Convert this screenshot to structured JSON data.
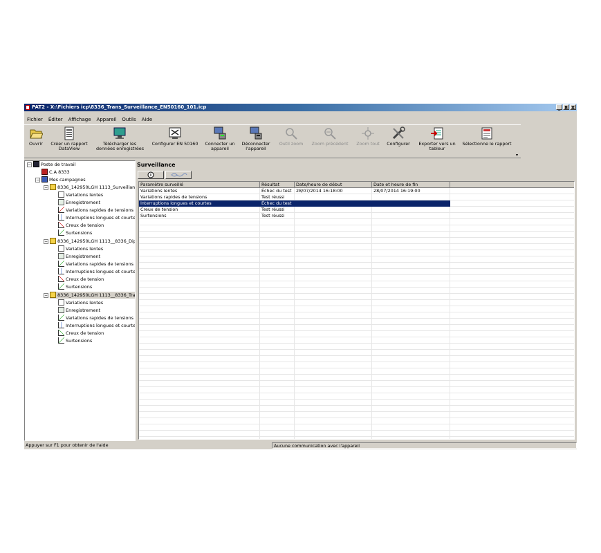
{
  "window": {
    "title": "PAT2 - X:\\Fichiers icp\\8336_Trans_Surveillance_EN50160_101.icp",
    "controls": [
      "_",
      "8",
      "X"
    ]
  },
  "menu": [
    "Fichier",
    "Éditer",
    "Affichage",
    "Appareil",
    "Outils",
    "Aide"
  ],
  "toolbar": [
    {
      "label1": "Ouvrir",
      "label2": "",
      "icon": "folder-open-icon",
      "enabled": true
    },
    {
      "label1": "Créer un rapport",
      "label2": "DataView",
      "icon": "report-icon",
      "enabled": true
    },
    {
      "label1": "Télécharger les",
      "label2": "données enregistrées",
      "icon": "download-icon",
      "enabled": true
    },
    {
      "label1": "Configurer EN 50160",
      "label2": "",
      "icon": "configure-en50160-icon",
      "enabled": true
    },
    {
      "label1": "Connecter un",
      "label2": "appareil",
      "icon": "connect-device-icon",
      "enabled": true
    },
    {
      "label1": "Déconnecter",
      "label2": "l'appareil",
      "icon": "disconnect-device-icon",
      "enabled": true
    },
    {
      "label1": "Outil zoom",
      "label2": "",
      "icon": "zoom-icon",
      "enabled": false
    },
    {
      "label1": "Zoom précédent",
      "label2": "",
      "icon": "zoom-previous-icon",
      "enabled": false
    },
    {
      "label1": "Zoom tout",
      "label2": "",
      "icon": "zoom-all-icon",
      "enabled": false
    },
    {
      "label1": "Configurer",
      "label2": "",
      "icon": "tools-icon",
      "enabled": true
    },
    {
      "label1": "Exporter vers un",
      "label2": "tableur",
      "icon": "export-icon",
      "enabled": true
    },
    {
      "label1": "Sélectionne le rapport",
      "label2": "",
      "icon": "select-report-icon",
      "enabled": true
    }
  ],
  "tree": {
    "root": "Poste de travail",
    "device": "C.A 8333",
    "campaigns": "Mes campagnes",
    "groups": [
      {
        "name": "8336_142950LGH 1113_Surveillanc",
        "children": [
          "Variations lentes",
          "Enregistrement",
          "Variations rapides de tensions",
          "Interruptions longues et courte",
          "Creux de tension",
          "Surtensions"
        ]
      },
      {
        "name": "8336_142950LGH 1113__8336_Dip",
        "children": [
          "Variations lentes",
          "Enregistrement",
          "Variations rapides de tensions",
          "Interruptions longues et courte",
          "Creux de tension",
          "Surtensions"
        ]
      },
      {
        "name": "8336_142950LGH 1113__8336_Tra",
        "children": [
          "Variations lentes",
          "Enregistrement",
          "Variations rapides de tensions",
          "Interruptions longues et courte",
          "Creux de tension",
          "Surtensions"
        ]
      }
    ]
  },
  "panel": {
    "title": "Surveillance",
    "columns": [
      "Paramètre surveillé",
      "Résultat",
      "Date/heure de début",
      "Date et heure de fin"
    ],
    "rows": [
      {
        "param": "Variations lentes",
        "result": "Échec du test",
        "start": "28/07/2014 16:18:00",
        "end": "28/07/2014 16:19:00",
        "selected": false
      },
      {
        "param": "Variations rapides de tensions",
        "result": "Test réussi",
        "start": "",
        "end": "",
        "selected": false
      },
      {
        "param": "Interruptions longues et courtes",
        "result": "Échec du test",
        "start": "",
        "end": "",
        "selected": true
      },
      {
        "param": "Creux de tension",
        "result": "Test réussi",
        "start": "",
        "end": "",
        "selected": false
      },
      {
        "param": "Surtensions",
        "result": "Test réussi",
        "start": "",
        "end": "",
        "selected": false
      }
    ]
  },
  "status": {
    "left": "Appuyer sur F1 pour obtenir de l'aide",
    "right": "Aucune communication avec l'appareil"
  },
  "colors": {
    "selection": "#0a246a",
    "titlebar": "#0a246a",
    "chrome": "#d4d0c8"
  }
}
